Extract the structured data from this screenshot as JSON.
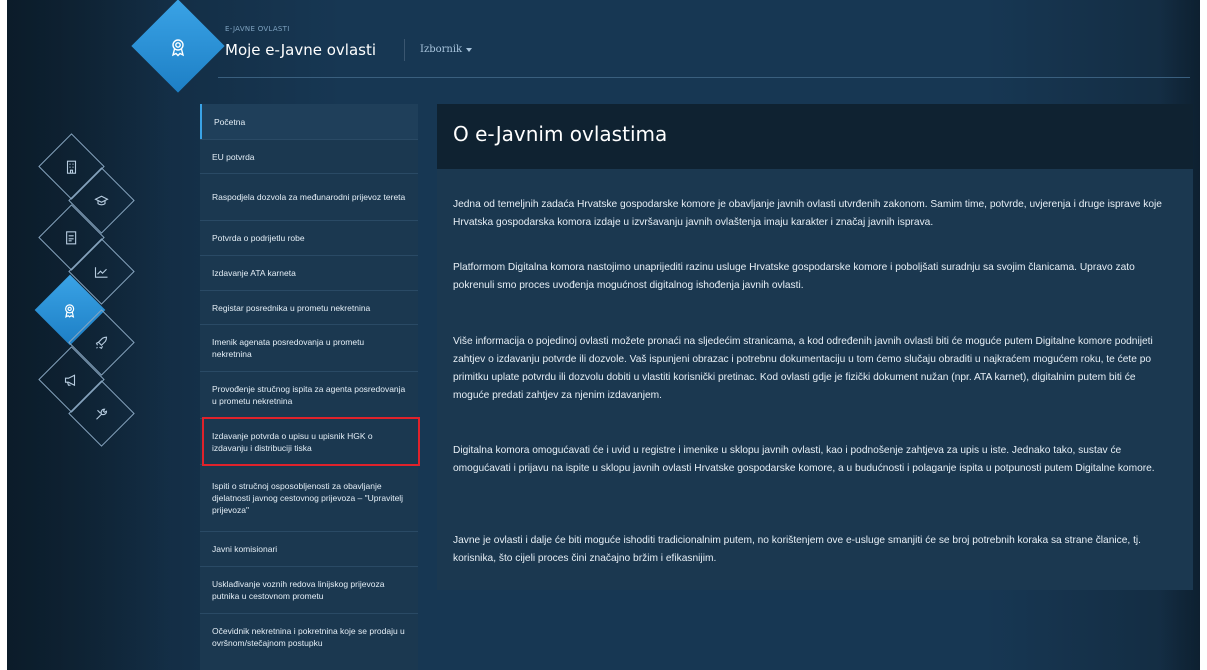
{
  "header": {
    "small_label": "E-JAVNE OVLASTI",
    "title": "Moje e-Javne ovlasti",
    "menu_label": "Izbornik"
  },
  "icons": {
    "logo": "award-icon",
    "left_rail": [
      "building-icon",
      "graduation-cap-icon",
      "document-icon",
      "chart-icon",
      "award-icon",
      "rocket-icon",
      "megaphone-icon",
      "tools-icon"
    ]
  },
  "colors": {
    "accent": "#2f93d8",
    "background": "#173753",
    "panel": "#1b3850",
    "highlight": "#e0222b"
  },
  "nav": {
    "items": [
      {
        "label": "Početna"
      },
      {
        "label": "EU potvrda"
      },
      {
        "label": "Raspodjela dozvola za međunarodni prijevoz tereta"
      },
      {
        "label": "Potvrda o podrijetlu robe"
      },
      {
        "label": "Izdavanje ATA karneta"
      },
      {
        "label": "Registar posrednika u prometu nekretnina"
      },
      {
        "label": "Imenik agenata posredovanja u prometu nekretnina"
      },
      {
        "label": "Provođenje stručnog ispita za agenta posredovanja u prometu nekretnina"
      },
      {
        "label": "Izdavanje potvrda o upisu u upisnik HGK o izdavanju i distribuciji tiska"
      },
      {
        "label": "Ispiti o stručnoj osposobljenosti za obavljanje djelatnosti javnog cestovnog prijevoza – \"Upravitelj prijevoza\""
      },
      {
        "label": "Javni komisionari"
      },
      {
        "label": "Usklađivanje voznih redova linijskog prijevoza putnika u cestovnom prometu"
      },
      {
        "label": "Očevidnik nekretnina i pokretnina koje se prodaju u ovršnom/stečajnom postupku"
      }
    ]
  },
  "main": {
    "title": "O e-Javnim ovlastima",
    "paragraphs": [
      "Jedna od temeljnih zadaća Hrvatske gospodarske komore je obavljanje javnih ovlasti utvrđenih zakonom. Samim time, potvrde, uvjerenja i druge isprave koje Hrvatska gospodarska komora izdaje u izvršavanju javnih ovlaštenja imaju karakter i značaj javnih isprava.",
      "Platformom Digitalna komora nastojimo unaprijediti razinu usluge Hrvatske gospodarske komore i poboljšati suradnju sa svojim članicama. Upravo zato pokrenuli smo proces uvođenja mogućnost digitalnog ishođenja javnih ovlasti.",
      "Više informacija o pojedinoj ovlasti možete pronaći na sljedećim stranicama, a kod određenih javnih ovlasti biti će moguće putem Digitalne komore podnijeti zahtjev o izdavanju potvrde ili dozvole. Vaš ispunjeni obrazac i potrebnu dokumentaciju u tom ćemo slučaju obraditi u najkraćem mogućem roku, te ćete po primitku uplate potvrdu ili dozvolu dobiti u vlastiti korisnički pretinac. Kod ovlasti gdje je fizički dokument nužan (npr. ATA karnet), digitalnim putem biti će moguće predati zahtjev za njenim izdavanjem.",
      "Digitalna komora omogućavati će i uvid u registre i imenike u sklopu javnih ovlasti, kao i podnošenje zahtjeva za upis u iste. Jednako tako, sustav će omogućavati i prijavu na ispite u sklopu javnih ovlasti Hrvatske gospodarske komore, a u budućnosti i polaganje ispita u potpunosti putem Digitalne komore.",
      "Javne je ovlasti i dalje će biti moguće ishoditi tradicionalnim putem, no korištenjem ove e-usluge smanjiti će se broj potrebnih koraka sa strane članice, tj. korisnika, što cijeli proces čini značajno bržim i efikasnijim."
    ]
  }
}
